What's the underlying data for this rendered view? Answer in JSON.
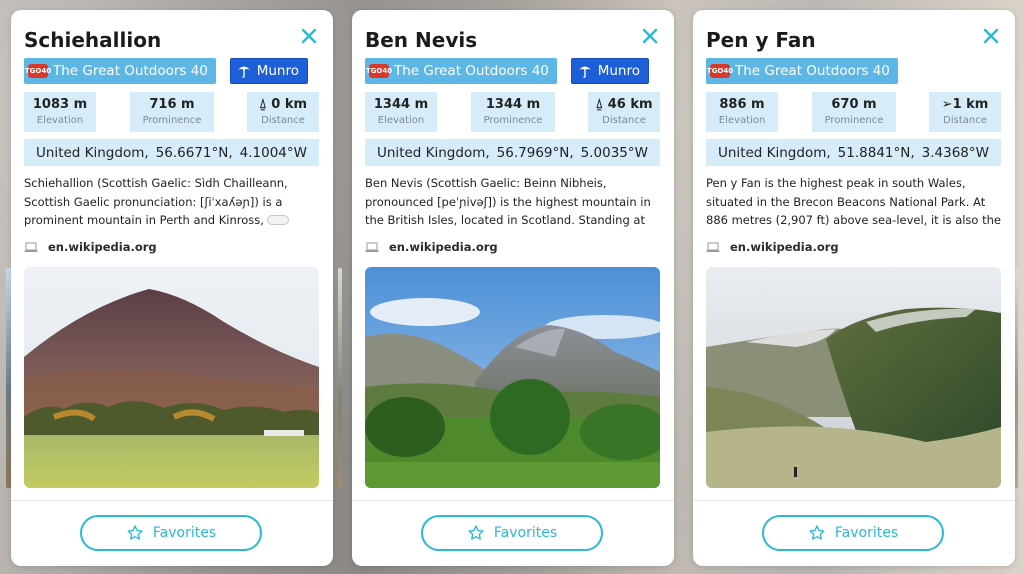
{
  "cards": [
    {
      "title": "Schiehallion",
      "tag": "The Great Outdoors 40",
      "tag_badge": "TGO40",
      "munro": "Munro",
      "elevation": "1083 m",
      "elevation_label": "Elevation",
      "prominence": "716 m",
      "prominence_label": "Prominence",
      "distance": "0 km",
      "distance_label": "Distance",
      "country": "United Kingdom,",
      "lat": "56.6671°N,",
      "lon": "4.1004°W",
      "description": "Schiehallion (Scottish Gaelic: Sìdh Chailleann, Scottish Gaelic pronunciation: [ʃiˈxaʎəɲ]) is a prominent mountain in Perth and Kinross,",
      "source": "en.wikipedia.org",
      "favorites": "Favorites"
    },
    {
      "title": "Ben Nevis",
      "tag": "The Great Outdoors 40",
      "tag_badge": "TGO40",
      "munro": "Munro",
      "elevation": "1344 m",
      "elevation_label": "Elevation",
      "prominence": "1344 m",
      "prominence_label": "Prominence",
      "distance": "46 km",
      "distance_label": "Distance",
      "country": "United Kingdom,",
      "lat": "56.7969°N,",
      "lon": "5.0035°W",
      "description": "Ben Nevis (Scottish Gaelic: Beinn Nibheis, pronounced [peˈɲivəʃ]) is the highest mountain in the British Isles, located in Scotland. Standing at",
      "source": "en.wikipedia.org",
      "favorites": "Favorites"
    },
    {
      "title": "Pen y Fan",
      "tag": "The Great Outdoors 40",
      "tag_badge": "TGO40",
      "elevation": "886 m",
      "elevation_label": "Elevation",
      "prominence": "670 m",
      "prominence_label": "Prominence",
      "distance": "1 km",
      "distance_label": "Distance",
      "country": "United Kingdom,",
      "lat": "51.8841°N,",
      "lon": "3.4368°W",
      "description": "Pen y Fan  is the highest peak in south Wales, situated in the Brecon Beacons National Park. At 886 metres (2,907 ft) above sea-level, it is also the highest",
      "source": "en.wikipedia.org",
      "favorites": "Favorites"
    }
  ],
  "colors": {
    "accent": "#2bb9d6",
    "tag_blue": "#5db7e6",
    "munro_blue": "#1d5fd8",
    "stat_bg": "#d6ecf8"
  },
  "icons": [
    "close-icon",
    "tgo40-badge-icon",
    "munro-umbrella-icon",
    "distance-arrow-icon",
    "laptop-icon",
    "star-icon"
  ]
}
